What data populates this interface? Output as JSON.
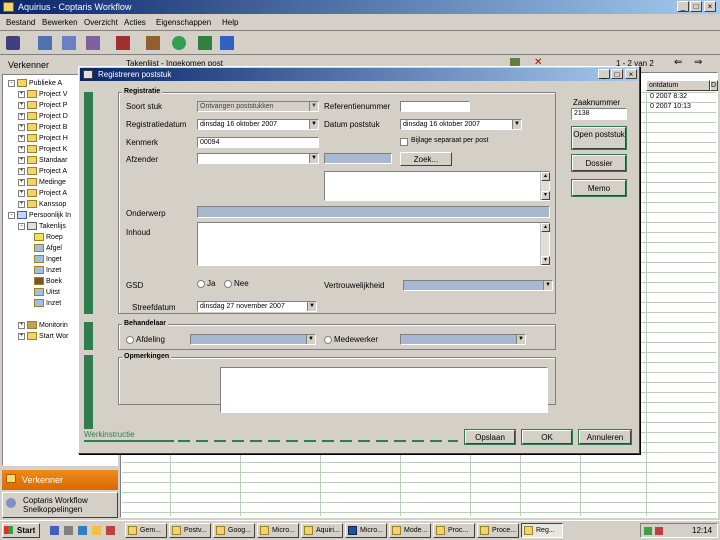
{
  "app": {
    "title": "Aquirius - Coptaris Workflow",
    "menu": [
      "Bestand",
      "Bewerken",
      "Overzicht",
      "Acties",
      "Eigenschappen",
      "Help"
    ]
  },
  "explorer": {
    "title": "Verkenner",
    "tree": [
      "Publieke A",
      "Project V",
      "Project P",
      "Project D",
      "Project B",
      "Project H",
      "Project K",
      "Standaar",
      "Project A",
      "Medinge",
      "Project A",
      "Kanssop",
      "Persoonlijk In",
      "Takenlijs",
      "Roep",
      "Afgel",
      "Inget",
      "Inzet",
      "Boek",
      "Uitst",
      "Inzet",
      "Monitorin",
      "Start Wor"
    ],
    "bottom_verkenner": "Verkenner",
    "bottom_snel": "Coptaris Workflow Snelkoppelingen"
  },
  "takenlijst": {
    "title": "Takenlijst - Ingekomen post",
    "pager": "1 - 2 van 2",
    "col_header": "ontdatum",
    "rows": [
      "0 2007 8:32",
      "0 2007 10:13"
    ]
  },
  "dialog": {
    "title": "Registreren poststuk",
    "section_registratie": "Registratie",
    "soortstuk_label": "Soort stuk",
    "soortstuk_value": "Ontvangen poststukken",
    "referentie_label": "Referentienummer",
    "registratiedatum_label": "Registratiedatum",
    "registratiedatum_value": "dinsdag 16 oktober 2007",
    "datum_poststuk_label": "Datum poststuk",
    "datum_poststuk_value": "dinsdag 16 oktober 2007",
    "kenmerk_label": "Kenmerk",
    "kenmerk_value": "00094",
    "bijlage_label": "Bijlage separaat per post",
    "afzender_label": "Afzender",
    "zoek_button": "Zoek...",
    "onderwerp_label": "Onderwerp",
    "inhoud_label": "Inhoud",
    "gsd_label": "GSD",
    "ja_label": "Ja",
    "nee_label": "Nee",
    "vertrouwelijkheid_label": "Vertrouwelijkheid",
    "streefdatum_label": "Streefdatum",
    "streefdatum_value": "dinsdag 27 november 2007",
    "section_behandelaar": "Behandelaar",
    "afdeling_label": "Afdeling",
    "medewerker_label": "Medewerker",
    "section_opmerkingen": "Opmerkingen",
    "zaaknummer_label": "Zaaknummer",
    "zaaknummer_value": "2138",
    "open_poststuk_button": "Open poststuk",
    "dossier_button": "Dossier",
    "memo_button": "Memo",
    "werkinstructie_label": "Werkinstructie",
    "opslaan_button": "Opslaan",
    "ok_button": "OK",
    "annuleren_button": "Annuleren"
  },
  "taskbar": {
    "start": "Start",
    "tasks": [
      "Gem...",
      "Postv...",
      "Goog...",
      "Micro...",
      "Aquiri...",
      "Micro...",
      "Mode...",
      "Proc...",
      "Proce...",
      "Reg..."
    ],
    "clock": "12:14"
  },
  "colors": {
    "accent_green": "#2e7d4f",
    "title_blue": "#0a246a",
    "field_blue": "#a8b8d0"
  }
}
